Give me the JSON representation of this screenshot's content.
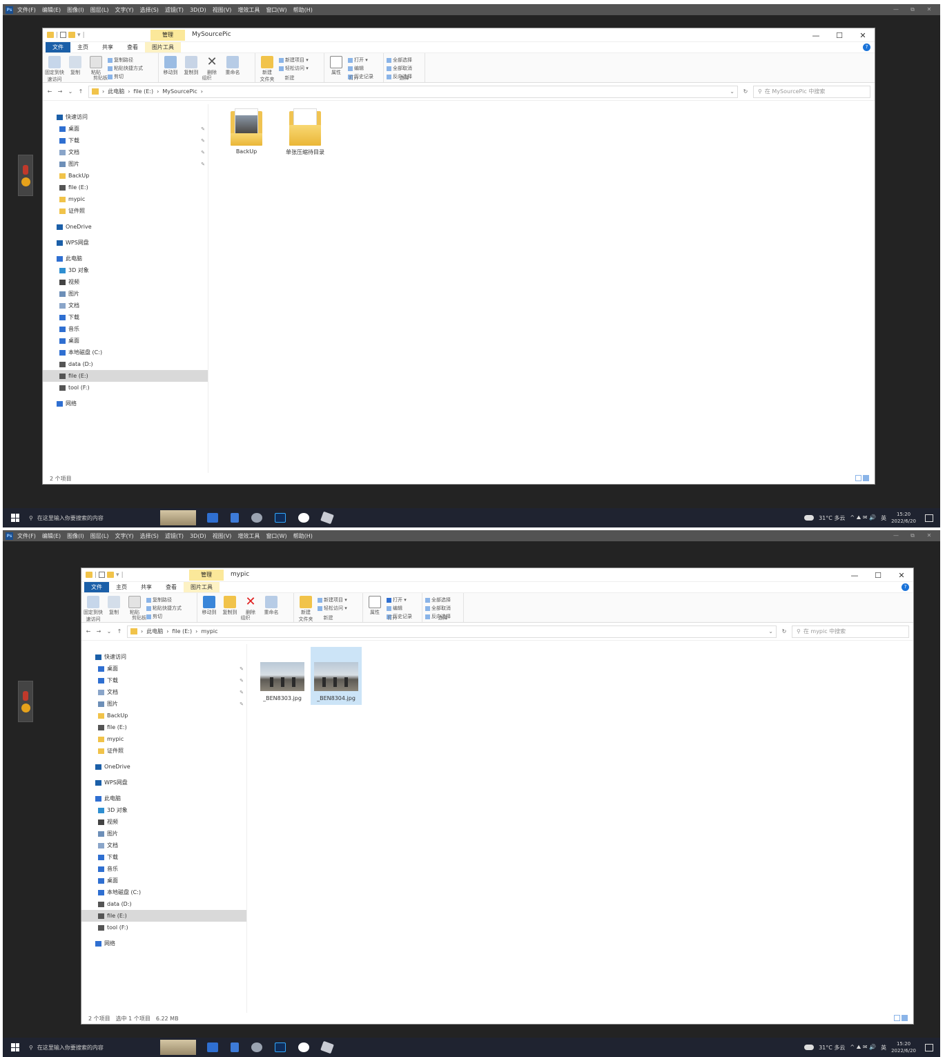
{
  "ps_menu": [
    "文件(F)",
    "编辑(E)",
    "图像(I)",
    "图层(L)",
    "文字(Y)",
    "选择(S)",
    "滤镜(T)",
    "3D(D)",
    "视图(V)",
    "增效工具",
    "窗口(W)",
    "帮助(H)"
  ],
  "ps_logo": "Ps",
  "ps_window_controls": [
    "—",
    "⧉",
    "✕"
  ],
  "explorer": {
    "manage_tab": "管理",
    "tabs": [
      "文件",
      "主页",
      "共享",
      "查看",
      "图片工具"
    ],
    "window_controls": [
      "—",
      "☐",
      "✕"
    ],
    "help": "?",
    "ribbon": {
      "clipboard": {
        "pin": "固定到快\n速访问",
        "copy": "复制",
        "paste": "粘贴",
        "copy_path": "复制路径",
        "paste_shortcut": "粘贴快捷方式",
        "cut": "剪切",
        "label": "剪贴板"
      },
      "organize": {
        "move_to": "移动到",
        "copy_to": "复制到",
        "delete": "删除",
        "rename": "重命名",
        "label": "组织"
      },
      "new": {
        "new_folder": "新建\n文件夹",
        "new_item": "新建项目 ▾",
        "easy_access": "轻松访问 ▾",
        "label": "新建"
      },
      "open": {
        "properties": "属性",
        "open": "打开 ▾",
        "edit": "编辑",
        "history": "历史记录",
        "label": "打开"
      },
      "select": {
        "select_all": "全部选择",
        "select_none": "全部取消",
        "invert": "反向选择",
        "label": "选择"
      }
    },
    "nav": [
      {
        "label": "快速访问",
        "level": 1,
        "icon": "star"
      },
      {
        "label": "桌面",
        "level": 2,
        "icon": "desktop",
        "pinned": true
      },
      {
        "label": "下载",
        "level": 2,
        "icon": "download",
        "pinned": true
      },
      {
        "label": "文档",
        "level": 2,
        "icon": "document",
        "pinned": true
      },
      {
        "label": "图片",
        "level": 2,
        "icon": "picture",
        "pinned": true
      },
      {
        "label": "BackUp",
        "level": 2,
        "icon": "folder"
      },
      {
        "label": "file (E:)",
        "level": 2,
        "icon": "drive"
      },
      {
        "label": "mypic",
        "level": 2,
        "icon": "folder"
      },
      {
        "label": "证件照",
        "level": 2,
        "icon": "folder"
      },
      {
        "label": "OneDrive",
        "level": 1,
        "icon": "cloud",
        "gap": true
      },
      {
        "label": "WPS网盘",
        "level": 1,
        "icon": "wps",
        "gap": true
      },
      {
        "label": "此电脑",
        "level": 1,
        "icon": "pc",
        "gap": true
      },
      {
        "label": "3D 对象",
        "level": 2,
        "icon": "cube"
      },
      {
        "label": "视频",
        "level": 2,
        "icon": "video"
      },
      {
        "label": "图片",
        "level": 2,
        "icon": "picture"
      },
      {
        "label": "文档",
        "level": 2,
        "icon": "document"
      },
      {
        "label": "下载",
        "level": 2,
        "icon": "download"
      },
      {
        "label": "音乐",
        "level": 2,
        "icon": "music"
      },
      {
        "label": "桌面",
        "level": 2,
        "icon": "desktop"
      },
      {
        "label": "本地磁盘 (C:)",
        "level": 2,
        "icon": "drive-c"
      },
      {
        "label": "data (D:)",
        "level": 2,
        "icon": "drive"
      },
      {
        "label": "file (E:)",
        "level": 2,
        "icon": "drive",
        "selected": true
      },
      {
        "label": "tool (F:)",
        "level": 2,
        "icon": "drive"
      },
      {
        "label": "网络",
        "level": 1,
        "icon": "network",
        "gap": true
      }
    ]
  },
  "window1": {
    "title": "MySourcePic",
    "breadcrumb": [
      "此电脑",
      "file (E:)",
      "MySourcePic"
    ],
    "search_placeholder": "在 MySourcePic 中搜索",
    "items": [
      {
        "name": "BackUp",
        "type": "folder-photo"
      },
      {
        "name": "单张压缩待目录",
        "type": "folder"
      }
    ],
    "status": "2 个项目"
  },
  "window2": {
    "title": "mypic",
    "breadcrumb": [
      "此电脑",
      "file (E:)",
      "mypic"
    ],
    "search_placeholder": "在 mypic 中搜索",
    "items": [
      {
        "name": "_BEN8303.jpg",
        "selected": false
      },
      {
        "name": "_BEN8304.jpg",
        "selected": true
      }
    ],
    "status": "2 个项目",
    "status_selected": "选中 1 个项目",
    "status_size": "6.22 MB"
  },
  "taskbar": {
    "search_placeholder": "在这里输入你要搜索的内容",
    "weather": "31°C 多云",
    "tray_icons": "^ ⛰ ✉ 🔊",
    "ime": "英",
    "time": "15:20",
    "date": "2022/6/20"
  },
  "colors": {
    "accent": "#1b5fa8",
    "folder": "#f1c34a",
    "manage": "#fbe89a",
    "selected": "#cce4f7",
    "taskbar": "#1f2330"
  }
}
